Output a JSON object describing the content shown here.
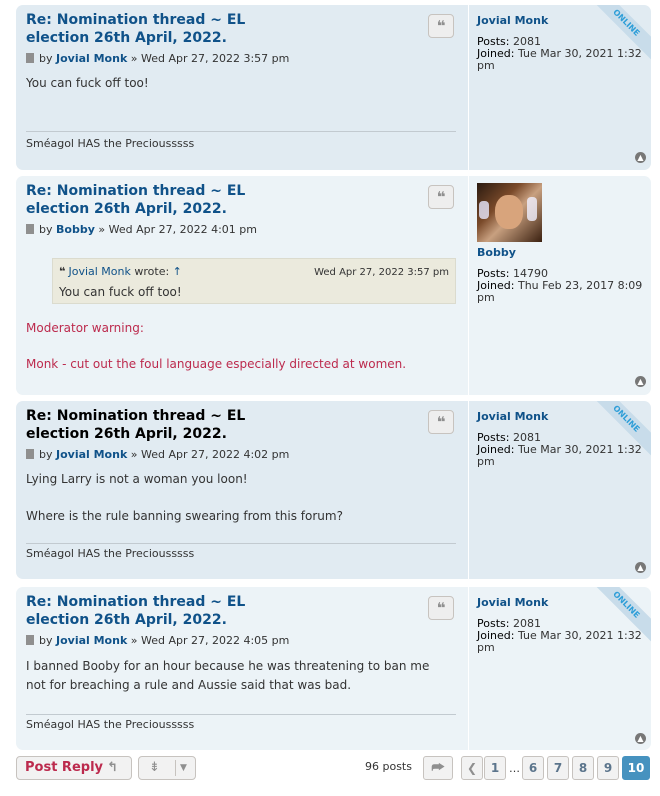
{
  "posts": [
    {
      "title": "Re: Nomination thread ~ EL election 26th April, 2022.",
      "by": "by",
      "author": "Jovial Monk",
      "date": "» Wed Apr 27, 2022 3:57 pm",
      "body": "You can fuck off too!",
      "signature": "Sméagol HAS the Preciousssss",
      "profile": {
        "name": "Jovial Monk",
        "posts_label": "Posts:",
        "posts": "2081",
        "joined_label": "Joined:",
        "joined": "Tue Mar 30, 2021 1:32 pm",
        "status": "ONLINE"
      }
    },
    {
      "title": "Re: Nomination thread ~ EL election 26th April, 2022.",
      "by": "by",
      "author": "Bobby",
      "date": "» Wed Apr 27, 2022 4:01 pm",
      "quote": {
        "author": "Jovial Monk",
        "wrote": "wrote:",
        "arrow": "↑",
        "date": "Wed Apr 27, 2022 3:57 pm",
        "text": "You can fuck off too!"
      },
      "warning_label": "Moderator warning:",
      "warning_text": "Monk - cut out the foul language especially directed at women.",
      "profile": {
        "name": "Bobby",
        "posts_label": "Posts:",
        "posts": "14790",
        "joined_label": "Joined:",
        "joined": "Thu Feb 23, 2017 8:09 pm"
      }
    },
    {
      "title": "Re: Nomination thread ~ EL election 26th April, 2022.",
      "by": "by",
      "author": "Jovial Monk",
      "date": "» Wed Apr 27, 2022 4:02 pm",
      "body1": "Lying Larry is not a woman you loon!",
      "body2": "Where is the rule banning swearing from this forum?",
      "signature": "Sméagol HAS the Preciousssss",
      "profile": {
        "name": "Jovial Monk",
        "posts_label": "Posts:",
        "posts": "2081",
        "joined_label": "Joined:",
        "joined": "Tue Mar 30, 2021 1:32 pm",
        "status": "ONLINE"
      }
    },
    {
      "title": "Re: Nomination thread ~ EL election 26th April, 2022.",
      "by": "by",
      "author": "Jovial Monk",
      "date": "» Wed Apr 27, 2022 4:05 pm",
      "body": "I banned Booby for an hour because he was threatening to ban me not for breaching a rule and Aussie said that was bad.",
      "signature": "Sméagol HAS the Preciousssss",
      "profile": {
        "name": "Jovial Monk",
        "posts_label": "Posts:",
        "posts": "2081",
        "joined_label": "Joined:",
        "joined": "Tue Mar 30, 2021 1:32 pm",
        "status": "ONLINE"
      }
    }
  ],
  "icons": {
    "quote": "quote-icon",
    "top": "chevron-up-icon",
    "doc": "document-icon"
  },
  "footer": {
    "reply_label": "Post Reply",
    "posts_count": "96 posts",
    "pages": [
      "1",
      "6",
      "7",
      "8",
      "9",
      "10"
    ],
    "ellipsis": "…",
    "current_page": "10"
  },
  "colors": {
    "accent": "#105289",
    "warning": "#bc2a4d",
    "active_page": "#4692bf"
  }
}
